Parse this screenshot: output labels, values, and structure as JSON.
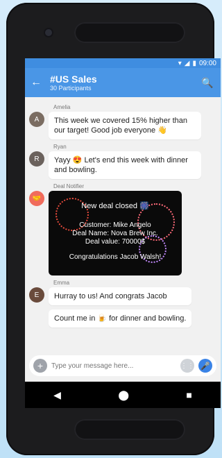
{
  "status": {
    "time": "09:00",
    "icons": [
      "wifi-icon",
      "signal-icon",
      "battery-icon"
    ]
  },
  "header": {
    "title": "#US Sales",
    "subtitle": "30 Participants"
  },
  "messages": [
    {
      "name": "Amelia",
      "text": "This week we covered 15% higher than our target! Good job everyone 👋"
    },
    {
      "name": "Ryan",
      "text": "Yayy 😍 Let's end this week with dinner and bowling."
    },
    {
      "name": "Deal Notifier",
      "deal": {
        "title": "New deal closed 🎆",
        "customer": "Customer: Mike Angelo",
        "deal_name": "Deal Name: Nova Brew Inc.",
        "deal_value": "Deal value: 70000$",
        "congrats": "Congratulations Jacob Walsh!"
      }
    },
    {
      "name": "Emma",
      "texts": [
        "Hurray to us! And congrats Jacob",
        "Count me in 🍺 for dinner and bowling."
      ]
    }
  ],
  "composer": {
    "placeholder": "Type your message here..."
  },
  "colors": {
    "appbar": "#4a96e6",
    "statusbar": "#3f8de0",
    "accent": "#3a83e6"
  }
}
